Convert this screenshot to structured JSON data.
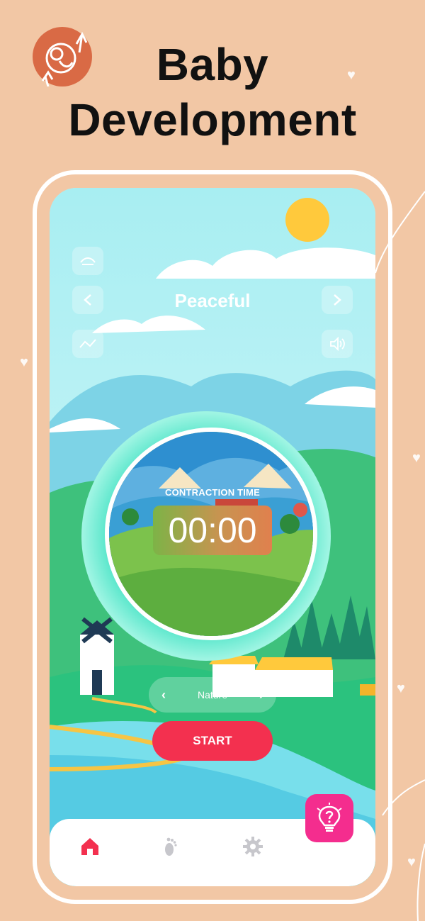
{
  "header": {
    "title_line1": "Baby",
    "title_line2": "Development",
    "logo_icon": "baby-growth-icon"
  },
  "player": {
    "sound_title": "Peaceful",
    "controls": {
      "top_left_icon": "sleep-eye-icon",
      "prev_icon": "chevron-left-icon",
      "next_icon": "chevron-right-icon",
      "graph_icon": "trend-graph-icon",
      "volume_icon": "speaker-icon"
    },
    "timer_label": "CONTRACTION TIME",
    "timer_value": "00:00",
    "category_label": "Nature",
    "start_label": "START"
  },
  "bottom_nav": {
    "items": [
      {
        "name": "home",
        "icon": "home-icon",
        "active": true
      },
      {
        "name": "baby",
        "icon": "footprint-icon",
        "active": false
      },
      {
        "name": "settings",
        "icon": "gear-icon",
        "active": false
      }
    ],
    "tip_icon": "lightbulb-question-icon"
  },
  "colors": {
    "background": "#F2C7A5",
    "accent_start": "#F3304F",
    "tip_button": "#F42D8E",
    "logo": "#D96A45",
    "ring": "#53E5C9",
    "nav_active": "#F3304F"
  }
}
